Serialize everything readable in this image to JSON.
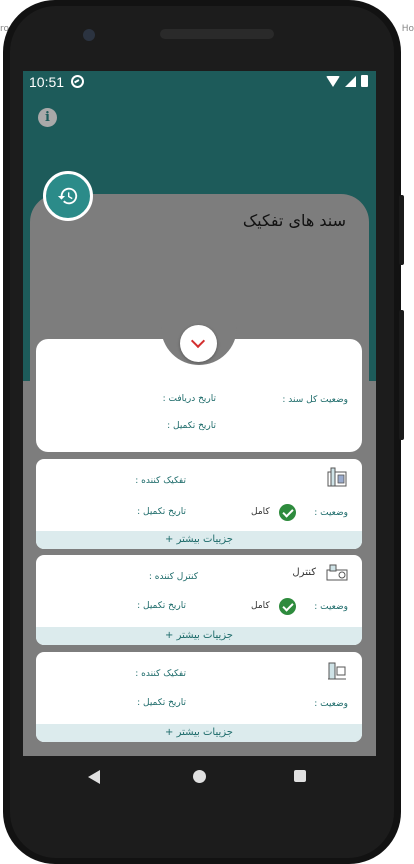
{
  "status_bar": {
    "time": "10:51"
  },
  "page": {
    "title": "سند های تفکیک"
  },
  "summary": {
    "status_label": "وضعیت کل سند :",
    "receive_date_label": "تاریخ دریافت :",
    "complete_date_label": "تاریخ تکمیل :"
  },
  "cards": [
    {
      "person_label": "تفکیک کننده :",
      "person_value": "",
      "status_label": "وضعیت :",
      "status_value": "کامل",
      "date_label": "تاریخ  تکمیل  :",
      "more_label": "جزییات بیشتر +",
      "completed": true,
      "icon": "sorting-machine-icon"
    },
    {
      "title": "کنترل",
      "person_label": "کنترل کننده :",
      "person_value": "",
      "status_label": "وضعیت :",
      "status_value": "کامل",
      "date_label": "تاریخ  تکمیل  :",
      "more_label": "جزییات بیشتر +",
      "completed": true,
      "icon": "control-machine-icon"
    },
    {
      "person_label": "تفکیک کننده :",
      "person_value": "",
      "status_label": "وضعیت :",
      "status_value": "",
      "date_label": "تاریخ  تکمیل  :",
      "more_label": "جزییات بیشتر +",
      "completed": false,
      "icon": "sorting-machine-icon"
    }
  ],
  "colors": {
    "header": "#1d5b5a",
    "accent": "#2b8b89",
    "label": "#1d6b6a",
    "check": "#2e8b3d",
    "chevron": "#d32f2f",
    "more_bar": "#dcebed"
  },
  "ghost": {
    "left": "ro",
    "right": "Ho"
  }
}
